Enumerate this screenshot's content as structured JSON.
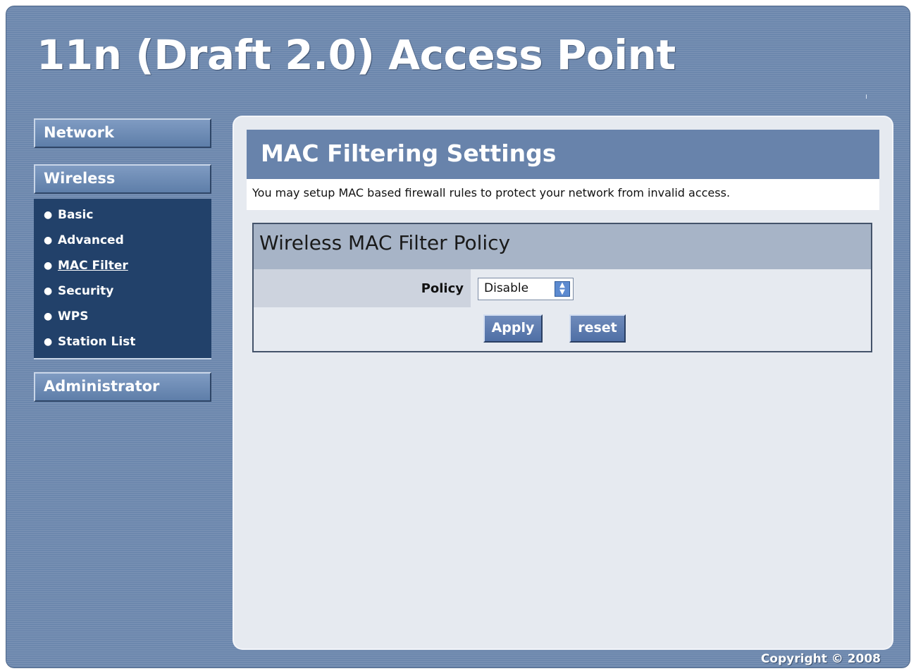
{
  "header": {
    "title": "11n (Draft 2.0) Access Point"
  },
  "sidebar": {
    "network_label": "Network",
    "wireless_label": "Wireless",
    "wireless_items": [
      {
        "label": "Basic",
        "active": false
      },
      {
        "label": "Advanced",
        "active": false
      },
      {
        "label": "MAC Filter",
        "active": true
      },
      {
        "label": "Security",
        "active": false
      },
      {
        "label": "WPS",
        "active": false
      },
      {
        "label": "Station List",
        "active": false
      }
    ],
    "administrator_label": "Administrator",
    "bullet": "●"
  },
  "main": {
    "page_title": "MAC Filtering Settings",
    "description": "You may setup MAC based firewall rules to protect your network from invalid access.",
    "policy_section": {
      "title": "Wireless MAC Filter Policy",
      "policy_label": "Policy",
      "policy_value": "Disable"
    },
    "apply_label": "Apply",
    "reset_label": "reset"
  },
  "footer": {
    "copyright": "Copyright © 2008"
  },
  "colors": {
    "frame_bg": "#6c87ad",
    "header_bar": "#6883ab",
    "submenu_bg": "#22416a",
    "panel_bg": "#e6eaf0",
    "section_title_bg": "#a7b4c7"
  },
  "icons": {
    "select_arrow": "up-down-arrows-icon"
  }
}
